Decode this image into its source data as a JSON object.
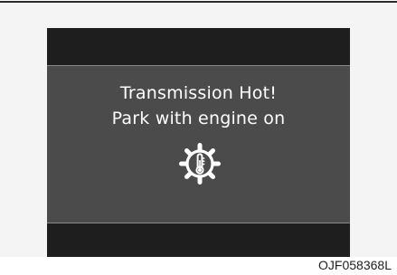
{
  "display": {
    "message_line_1": "Transmission Hot!",
    "message_line_2": "Park with engine on",
    "icon": "transmission-temperature-warning-icon"
  },
  "figure_code": "OJF058368L",
  "colors": {
    "display_frame": "#1e1e1e",
    "display_screen": "#4b4b4b",
    "message_text": "#ffffff",
    "page_background": "#f4f4f4"
  }
}
